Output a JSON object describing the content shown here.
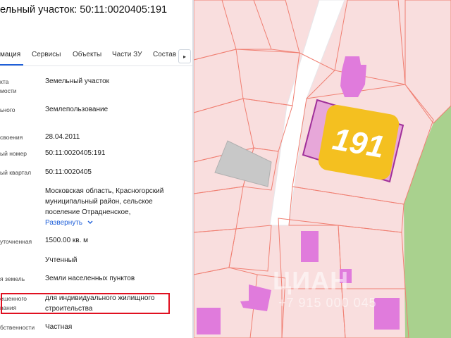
{
  "panel": {
    "title": "ельный участок: 50:11:0020405:191",
    "tabs": [
      "мация",
      "Сервисы",
      "Объекты",
      "Части ЗУ",
      "Состав"
    ],
    "tab_next": "▸",
    "fields": [
      {
        "label": [
          "кта",
          "мости"
        ],
        "value": [
          "Земельный участок"
        ]
      },
      {
        "label": [
          "ьного"
        ],
        "value": [
          "Землепользование"
        ]
      },
      {
        "label": [
          "своения"
        ],
        "value": [
          "28.04.2011"
        ]
      },
      {
        "label": [
          "ый номер"
        ],
        "value": [
          "50:11:0020405:191"
        ]
      },
      {
        "label": [
          "ый квартал"
        ],
        "value": [
          "50:11:0020405"
        ]
      },
      {
        "label": [],
        "value": [
          "Московская область, Красногорский",
          "муниципальный район, сельское",
          "поселение Отрадненское,"
        ]
      },
      {
        "label": [
          "уточненная"
        ],
        "value": [
          "1500.00 кв. м"
        ]
      },
      {
        "label": [],
        "value": [
          "Учтенный"
        ]
      },
      {
        "label": [
          "я земель"
        ],
        "value": [
          "Земли населенных пунктов"
        ]
      },
      {
        "label": [
          "ешенного",
          "вания"
        ],
        "value": [
          "для индивидуального жилищного",
          "строительства"
        ]
      },
      {
        "label": [
          "бственности"
        ],
        "value": [
          "Частная"
        ]
      }
    ],
    "expand_label": "Развернуть"
  },
  "map": {
    "parcel_label": "191",
    "watermark": "ЦИАН",
    "watermark_phone": "+7 915 000 045"
  },
  "colors": {
    "accent": "#1e5fd9",
    "highlight": "#e01020",
    "parcel_fill": "#f9dede",
    "parcel_stroke": "#f07f72",
    "building": "#e07bdc",
    "selected_parcel": "#a0309a",
    "label_badge": "#f4c020",
    "forest": "#a9d18e",
    "road": "#ffffff",
    "gray_area": "#c8c8c8"
  }
}
